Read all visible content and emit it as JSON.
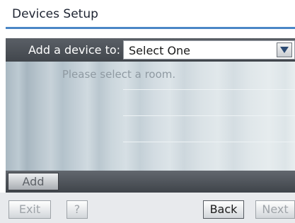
{
  "title": "Devices Setup",
  "colors": {
    "title_rule": "#4a86c6",
    "header_bar": "#4b5056",
    "list_background": "#cfd8de"
  },
  "device_row": {
    "label": "Add a device to:",
    "select_value": "Select One",
    "dropdown_icon": "triangle-down-icon"
  },
  "list": {
    "empty_message": "Please select a room."
  },
  "toolbar": {
    "add_label": "Add"
  },
  "footer": {
    "exit_label": "Exit",
    "help_label": "?",
    "back_label": "Back",
    "next_label": "Next"
  }
}
